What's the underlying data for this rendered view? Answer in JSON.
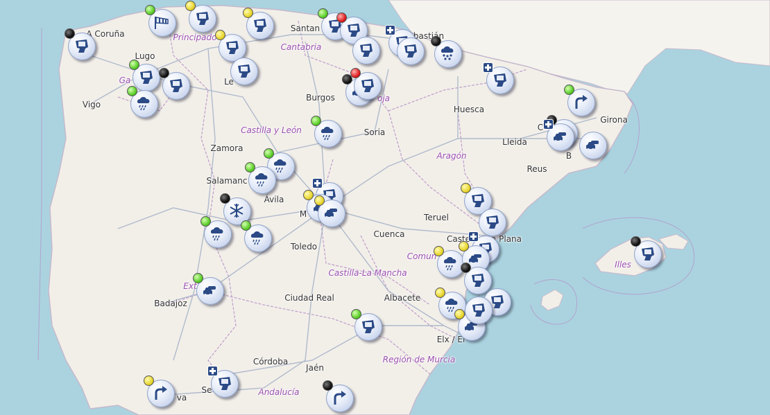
{
  "colors": {
    "sea": "#aad3df",
    "land": "#f2efe9",
    "neighbor": "#f5f3ee",
    "road": "#a8b4c8",
    "border": "#b58ec4",
    "icon": "#2b4a86"
  },
  "labels": [
    {
      "id": "a-coruna",
      "text": "A Coruña",
      "kind": "city"
    },
    {
      "id": "lugo",
      "text": "Lugo",
      "kind": "city"
    },
    {
      "id": "vigo",
      "text": "Vigo",
      "kind": "city"
    },
    {
      "id": "le",
      "text": "Le",
      "kind": "city"
    },
    {
      "id": "burgos",
      "text": "Burgos",
      "kind": "city"
    },
    {
      "id": "santan",
      "text": "Santan",
      "kind": "city"
    },
    {
      "id": "bastian",
      "text": "bastián",
      "kind": "city"
    },
    {
      "id": "huesca",
      "text": "Huesca",
      "kind": "city"
    },
    {
      "id": "girona",
      "text": "Girona",
      "kind": "city"
    },
    {
      "id": "lleida",
      "text": "Lleida",
      "kind": "city"
    },
    {
      "id": "soria",
      "text": "Soria",
      "kind": "city"
    },
    {
      "id": "zamora",
      "text": "Zamora",
      "kind": "city"
    },
    {
      "id": "salamanca",
      "text": "Salamanc",
      "kind": "city"
    },
    {
      "id": "avila",
      "text": "Ávila",
      "kind": "city"
    },
    {
      "id": "reus",
      "text": "Reus",
      "kind": "city"
    },
    {
      "id": "teruel",
      "text": "Teruel",
      "kind": "city"
    },
    {
      "id": "castellon",
      "text": "Caste",
      "kind": "city"
    },
    {
      "id": "la-plana",
      "text": "a Plana",
      "kind": "city"
    },
    {
      "id": "toledo",
      "text": "Toledo",
      "kind": "city"
    },
    {
      "id": "cuenca",
      "text": "Cuenca",
      "kind": "city"
    },
    {
      "id": "badajoz",
      "text": "Badajoz",
      "kind": "city"
    },
    {
      "id": "ciudad-real",
      "text": "Ciudad Real",
      "kind": "city"
    },
    {
      "id": "albacete",
      "text": "Albacete",
      "kind": "city"
    },
    {
      "id": "elx",
      "text": "Elx / El",
      "kind": "city"
    },
    {
      "id": "cordoba",
      "text": "Córdoba",
      "kind": "city"
    },
    {
      "id": "jaen",
      "text": "Jaén",
      "kind": "city"
    },
    {
      "id": "se",
      "text": "Se",
      "kind": "city"
    },
    {
      "id": "va",
      "text": "va",
      "kind": "city"
    },
    {
      "id": "m",
      "text": "M",
      "kind": "city"
    },
    {
      "id": "ba",
      "text": "B",
      "kind": "city"
    },
    {
      "id": "c",
      "text": "C",
      "kind": "city"
    },
    {
      "id": "ga",
      "text": "Ga",
      "kind": "city"
    },
    {
      "id": "principado",
      "text": "Principado",
      "kind": "region"
    },
    {
      "id": "cantabria",
      "text": "Cantabria",
      "kind": "region"
    },
    {
      "id": "castilla-leon",
      "text": "Castilla y León",
      "kind": "region"
    },
    {
      "id": "aragon",
      "text": "Aragón",
      "kind": "region"
    },
    {
      "id": "castilla-la-mancha",
      "text": "Castilla-La Mancha",
      "kind": "region"
    },
    {
      "id": "comun",
      "text": "Comun",
      "kind": "region"
    },
    {
      "id": "extremadura",
      "text": "Ext",
      "kind": "region"
    },
    {
      "id": "murcia",
      "text": "Región de Murcia",
      "kind": "region"
    },
    {
      "id": "andalucia",
      "text": "Andalucía",
      "kind": "region"
    },
    {
      "id": "illes",
      "text": "Illes",
      "kind": "region"
    },
    {
      "id": "oja",
      "text": "oja",
      "kind": "region"
    }
  ],
  "markers": [
    {
      "id": "m01",
      "icon": "camera-icon",
      "status": "black"
    },
    {
      "id": "m02",
      "icon": "windsock-icon",
      "status": "green"
    },
    {
      "id": "m03",
      "icon": "camera-icon",
      "status": "yellow"
    },
    {
      "id": "m04",
      "icon": "camera-icon",
      "status": "yellow"
    },
    {
      "id": "m05",
      "icon": "camera-icon",
      "status": "yellow"
    },
    {
      "id": "m06",
      "icon": "camera-icon",
      "status": ""
    },
    {
      "id": "m07",
      "icon": "camera-icon",
      "status": "green"
    },
    {
      "id": "m08",
      "icon": "camera-icon",
      "status": "black"
    },
    {
      "id": "m09",
      "icon": "rain-icon",
      "status": "green"
    },
    {
      "id": "m10",
      "icon": "camera-icon",
      "status": "green"
    },
    {
      "id": "m11",
      "icon": "camera-icon",
      "status": "red"
    },
    {
      "id": "m12",
      "icon": "camera-icon",
      "status": ""
    },
    {
      "id": "m13",
      "icon": "camera-icon",
      "status": "plus"
    },
    {
      "id": "m14",
      "icon": "camera-icon",
      "status": ""
    },
    {
      "id": "m15",
      "icon": "hail-icon",
      "status": "black"
    },
    {
      "id": "m16",
      "icon": "camera-icon",
      "status": "plus"
    },
    {
      "id": "m17",
      "icon": "traffic-icon",
      "status": "black"
    },
    {
      "id": "m18",
      "icon": "camera-icon",
      "status": "red"
    },
    {
      "id": "m19",
      "icon": "turn-arrow-icon",
      "status": "green"
    },
    {
      "id": "m20",
      "icon": "traffic-icon",
      "status": "black"
    },
    {
      "id": "m21",
      "icon": "traffic-icon",
      "status": "plus"
    },
    {
      "id": "m22",
      "icon": "traffic-icon",
      "status": ""
    },
    {
      "id": "m23",
      "icon": "rain-icon",
      "status": "green"
    },
    {
      "id": "m24",
      "icon": "rain-icon",
      "status": "green"
    },
    {
      "id": "m25",
      "icon": "rain-icon",
      "status": "green"
    },
    {
      "id": "m26",
      "icon": "camera-icon",
      "status": "plus"
    },
    {
      "id": "m27",
      "icon": "traffic-icon",
      "status": "yellow"
    },
    {
      "id": "m28",
      "icon": "traffic-icon",
      "status": "yellow"
    },
    {
      "id": "m29",
      "icon": "snowflake-icon",
      "status": "black"
    },
    {
      "id": "m30",
      "icon": "rain-icon",
      "status": "green"
    },
    {
      "id": "m31",
      "icon": "rain-icon",
      "status": "green"
    },
    {
      "id": "m32",
      "icon": "camera-icon",
      "status": "yellow"
    },
    {
      "id": "m33",
      "icon": "camera-icon",
      "status": ""
    },
    {
      "id": "m34",
      "icon": "camera-icon",
      "status": "plus"
    },
    {
      "id": "m35",
      "icon": "rain-icon",
      "status": "yellow"
    },
    {
      "id": "m36",
      "icon": "traffic-icon",
      "status": "yellow"
    },
    {
      "id": "m37",
      "icon": "camera-icon",
      "status": "black"
    },
    {
      "id": "m38",
      "icon": "camera-icon",
      "status": ""
    },
    {
      "id": "m39",
      "icon": "rain-icon",
      "status": "yellow"
    },
    {
      "id": "m40",
      "icon": "traffic-icon",
      "status": "yellow"
    },
    {
      "id": "m41",
      "icon": "camera-icon",
      "status": ""
    },
    {
      "id": "m42",
      "icon": "traffic-icon",
      "status": "green"
    },
    {
      "id": "m43",
      "icon": "camera-icon",
      "status": "green"
    },
    {
      "id": "m44",
      "icon": "camera-icon",
      "status": "plus"
    },
    {
      "id": "m45",
      "icon": "turn-arrow-icon",
      "status": "yellow"
    },
    {
      "id": "m46",
      "icon": "turn-arrow-icon",
      "status": "black"
    },
    {
      "id": "m47",
      "icon": "camera-icon",
      "status": "black"
    }
  ]
}
